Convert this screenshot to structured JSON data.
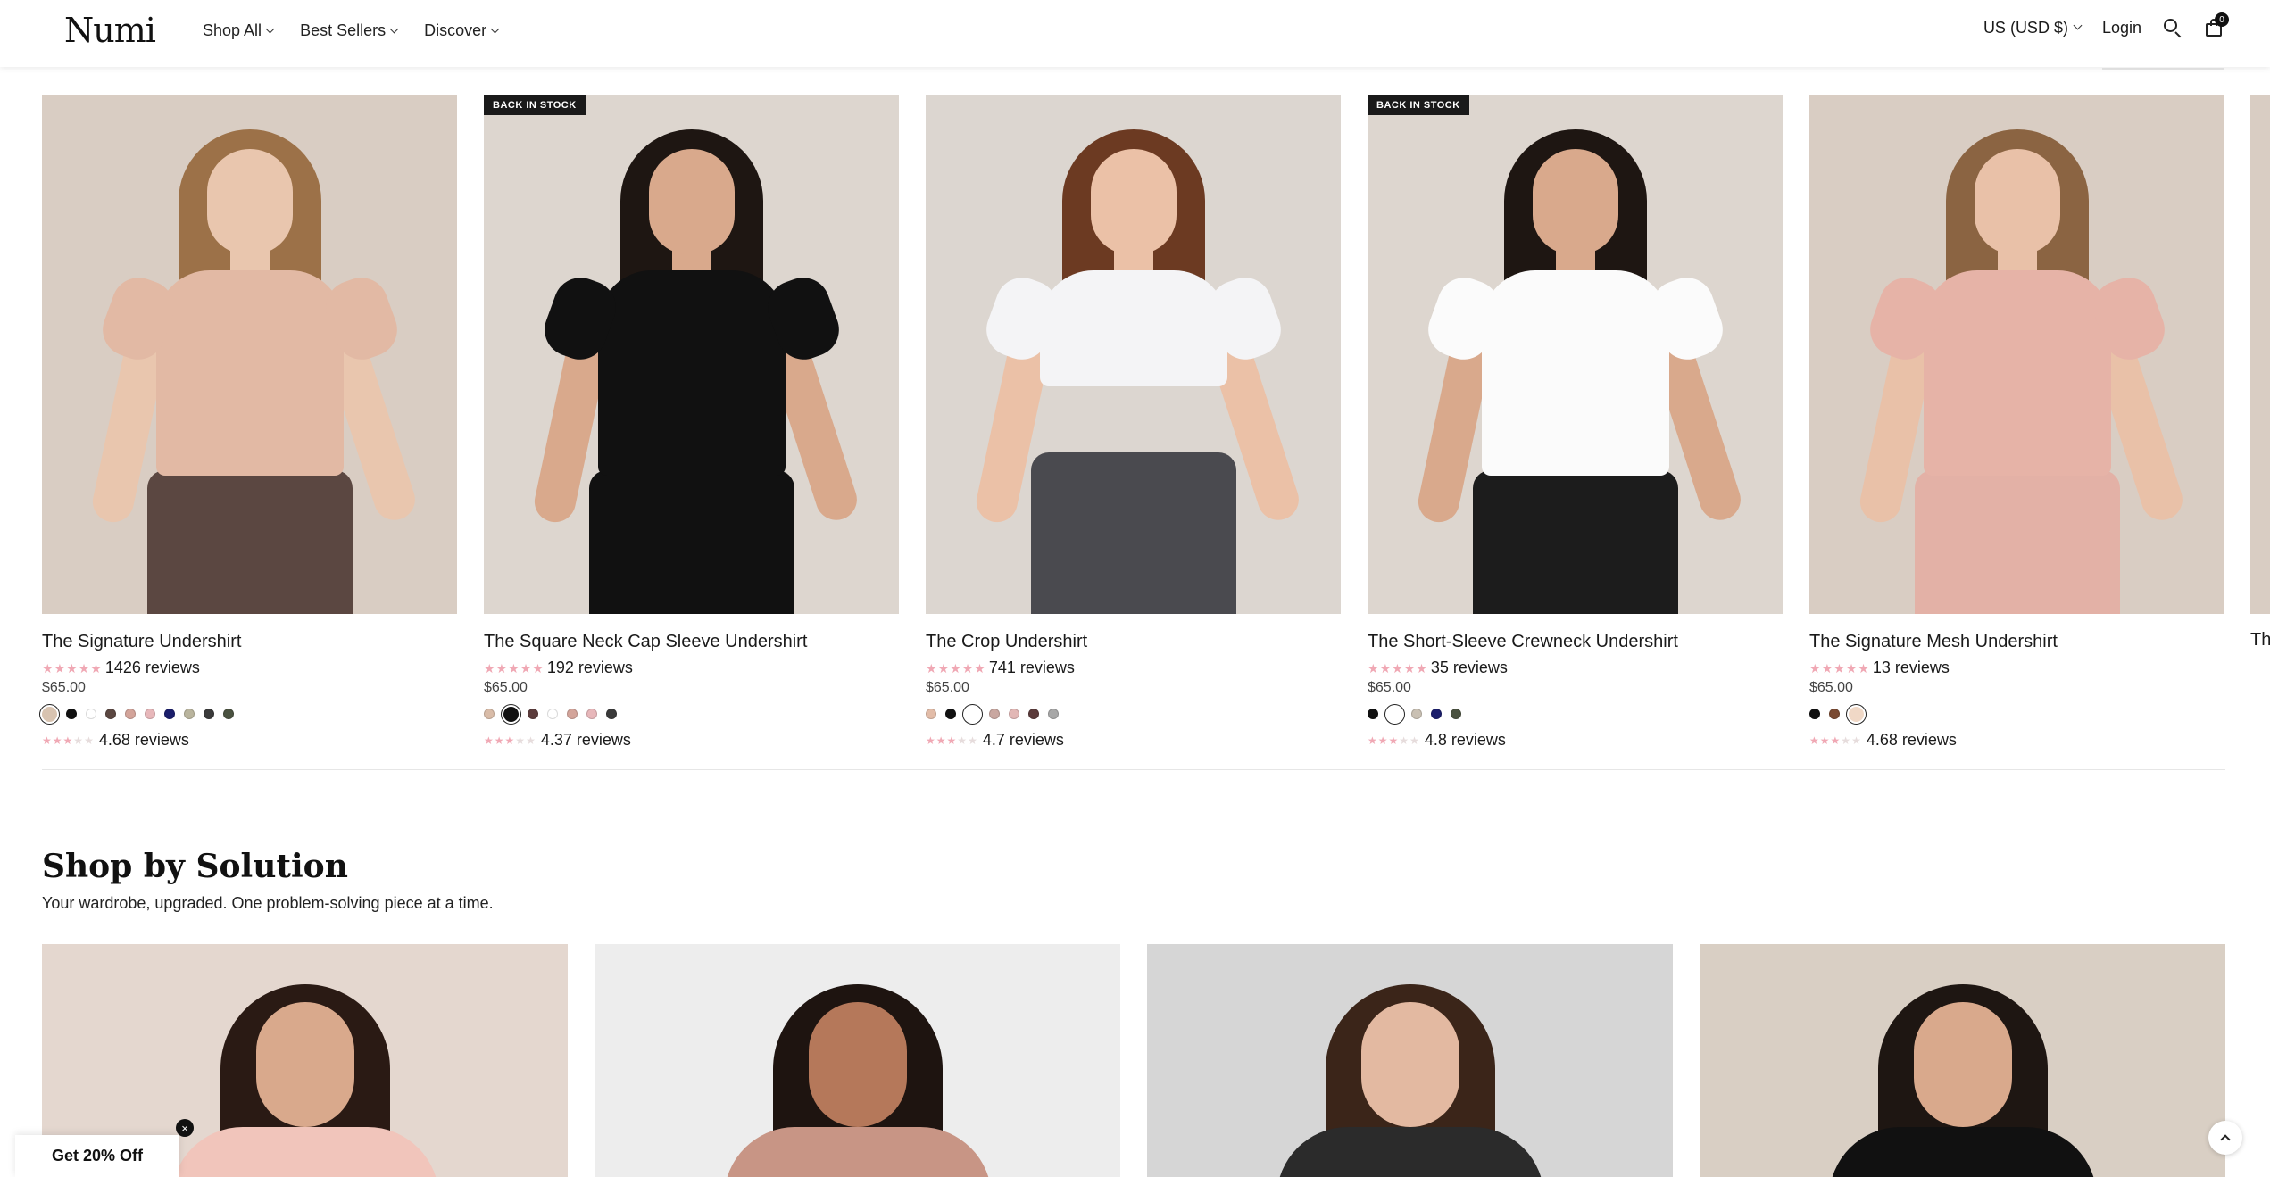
{
  "header": {
    "logo": "Numi",
    "nav": [
      {
        "label": "Shop All"
      },
      {
        "label": "Best Sellers"
      },
      {
        "label": "Discover"
      }
    ],
    "currency": "US (USD $)",
    "login": "Login",
    "cart_count": "0"
  },
  "products": [
    {
      "title": "The Signature Undershirt",
      "reviews": "1426 reviews",
      "price": "$65.00",
      "badge": "",
      "rating2": "4.68 reviews",
      "bg": "#d9cdc3",
      "skin": "#e9c6ae",
      "hair": "#9c7148",
      "top": "#e2b9a4",
      "bottom": "#5b4741",
      "swatches": [
        "#d8c3b0",
        "#111111",
        "#ffffff",
        "#5b4741",
        "#d3a49a",
        "#e7b7ba",
        "#1a1d6b",
        "#b9b49d",
        "#3a3a3a",
        "#4a5240"
      ],
      "selected": 0
    },
    {
      "title": "The Square Neck Cap Sleeve Undershirt",
      "reviews": "192 reviews",
      "price": "$65.00",
      "badge": "BACK IN STOCK",
      "rating2": "4.37 reviews",
      "bg": "#ddd6cf",
      "skin": "#d9a98c",
      "hair": "#1e1612",
      "top": "#111111",
      "bottom": "#111111",
      "swatches": [
        "#d9bca8",
        "#111111",
        "#5b3b3b",
        "#ffffff",
        "#d3a49a",
        "#e7b7ba",
        "#3a3a3a"
      ],
      "selected": 1
    },
    {
      "title": "The Crop Undershirt",
      "reviews": "741 reviews",
      "price": "$65.00",
      "badge": "",
      "rating2": "4.7 reviews",
      "bg": "#dcd6d0",
      "skin": "#ebc1a7",
      "hair": "#6c3a22",
      "top": "#f4f4f6",
      "bottom": "#4a4a4f",
      "swatches": [
        "#e2bca8",
        "#111111",
        "#ffffff",
        "#c9a7a0",
        "#e2b7b5",
        "#5b3b3b",
        "#a7a7a7"
      ],
      "selected": 2
    },
    {
      "title": "The Short-Sleeve Crewneck Undershirt",
      "reviews": "35 reviews",
      "price": "$65.00",
      "badge": "BACK IN STOCK",
      "rating2": "4.8 reviews",
      "bg": "#ddd6cf",
      "skin": "#d9a98c",
      "hair": "#1e1612",
      "top": "#fbfbfb",
      "bottom": "#1c1c1c",
      "swatches": [
        "#111111",
        "#ffffff",
        "#c9c0b3",
        "#1a1d6b",
        "#4a5240"
      ],
      "selected": 1
    },
    {
      "title": "The Signature Mesh Undershirt",
      "reviews": "13 reviews",
      "price": "$65.00",
      "badge": "",
      "rating2": "4.68 reviews",
      "bg": "#d9cdc3",
      "skin": "#e9c1a8",
      "hair": "#8b6442",
      "top": "#e6b3a7",
      "bottom": "#e3b1a6",
      "swatches": [
        "#111111",
        "#7a4a32",
        "#f0d8c6"
      ],
      "selected": 2
    }
  ],
  "partial_product": {
    "title": "Th"
  },
  "section": {
    "title": "Shop by Solution",
    "subtitle": "Your wardrobe, upgraded. One problem-solving piece at a time."
  },
  "solutions": [
    {
      "bg": "#e4d7cf",
      "hair": "#2a1a14",
      "skin": "#d9a98c",
      "cloth": "#f1c5bb"
    },
    {
      "bg": "#ededed",
      "hair": "#1e1410",
      "skin": "#b5785a",
      "cloth": "#c89585"
    },
    {
      "bg": "#d6d6d6",
      "hair": "#3b2519",
      "skin": "#e3b9a1",
      "cloth": "#2b2b2b"
    },
    {
      "bg": "#d9cfc4",
      "hair": "#1e1612",
      "skin": "#d9a98c",
      "cloth": "#111111"
    }
  ],
  "promo": {
    "label": "Get 20% Off",
    "close": "×"
  },
  "colors": {
    "star": "#f0a8b4",
    "badge_bg": "#1a1a1a"
  },
  "icons": [
    "search-icon",
    "cart-icon",
    "close-icon",
    "chevron-up-icon",
    "chevron-down-icon",
    "star-icon"
  ]
}
